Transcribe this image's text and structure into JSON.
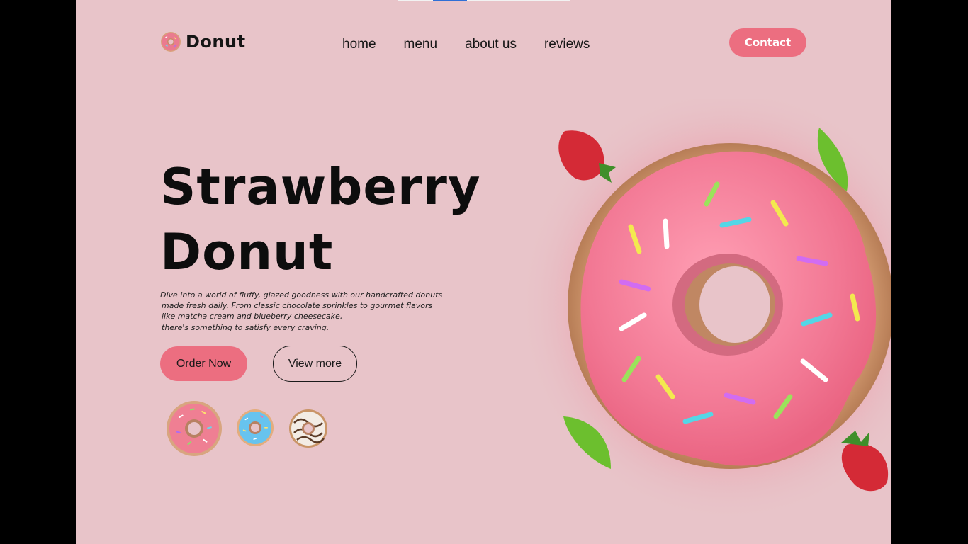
{
  "brand": {
    "name": "Donut"
  },
  "nav": {
    "items": [
      "home",
      "menu",
      "about us",
      "reviews"
    ]
  },
  "header": {
    "contact_label": "Contact"
  },
  "hero": {
    "title_line1": "Strawberry",
    "title_line2": "Donut",
    "description_lines": [
      "Dive into a world of fluffy, glazed goodness with our handcrafted donuts",
      "made fresh daily. From classic chocolate sprinkles to gourmet flavors",
      "like matcha cream and blueberry cheesecake,",
      "there's something to satisfy every craving."
    ],
    "order_label": "Order Now",
    "view_label": "View more"
  },
  "thumbnails": [
    {
      "icon": "strawberry-donut-icon",
      "selected": true
    },
    {
      "icon": "blue-donut-icon"
    },
    {
      "icon": "vanilla-donut-icon"
    }
  ],
  "colors": {
    "page_bg": "#e8c4c9",
    "accent": "#ec6e80",
    "text": "#0d0d0d"
  }
}
